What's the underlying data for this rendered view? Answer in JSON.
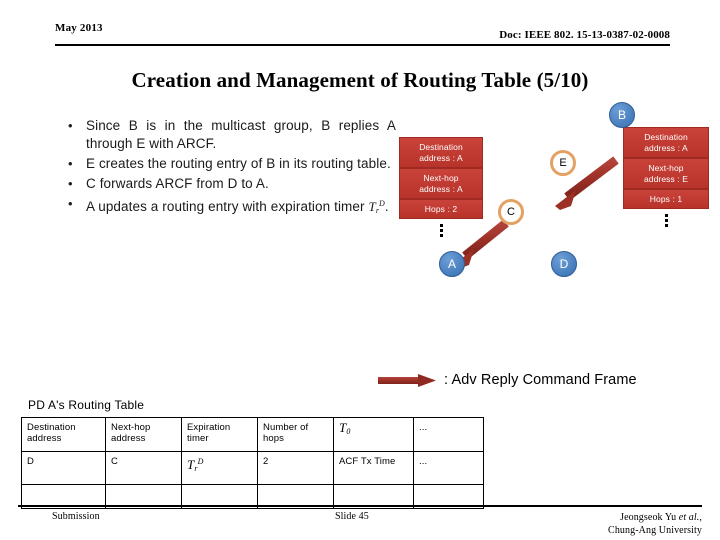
{
  "header": {
    "date": "May 2013",
    "doc": "Doc: IEEE 802. 15-13-0387-02-0008"
  },
  "title": "Creation and Management of Routing Table (5/10)",
  "bullets": [
    {
      "marker": "•",
      "text": "Since B is in the multicast group, B replies A through E with ARCF."
    },
    {
      "marker": "•",
      "text": "E creates the routing entry of B in its routing table."
    },
    {
      "marker": "•",
      "text": "C forwards ARCF from D to A."
    },
    {
      "marker": "•",
      "text": "A updates a routing entry with expiration timer"
    }
  ],
  "bullet_math": {
    "base": "T",
    "sub": "r",
    "sup": "D",
    "trail": "."
  },
  "diagram": {
    "nodes": [
      {
        "id": "node-b",
        "label": "B",
        "style": "filled"
      },
      {
        "id": "node-e",
        "label": "E",
        "style": "ring"
      },
      {
        "id": "node-c",
        "label": "C",
        "style": "ring"
      },
      {
        "id": "node-a",
        "label": "A",
        "style": "filled"
      },
      {
        "id": "node-d",
        "label": "D",
        "style": "filled"
      }
    ],
    "left_box": {
      "destination": "Destination\naddress : A",
      "destination_line1": "Destination",
      "destination_line2": "address : A",
      "nexthop_line1": "Next-hop",
      "nexthop_line2": "address : A",
      "hops": "Hops : 2"
    },
    "right_box": {
      "destination_line1": "Destination",
      "destination_line2": "address : A",
      "nexthop_line1": "Next-hop",
      "nexthop_line2": "address : E",
      "hops": "Hops : 1"
    },
    "colors": {
      "box_red": "#c0392b",
      "node_blue": "#4a80c0",
      "node_ring_orange": "#e3a264",
      "arrow_red": "#a83a30"
    }
  },
  "legend": {
    "label": ": Adv Reply Command Frame"
  },
  "routing_table": {
    "caption": "PD A's Routing Table",
    "columns": [
      "Destination\naddress",
      "Next-hop\naddress",
      "Expiration\ntimer",
      "Number of\nhops",
      "T0",
      "..."
    ],
    "columns_split": [
      {
        "l1": "Destination",
        "l2": "address"
      },
      {
        "l1": "Next-hop",
        "l2": "address"
      },
      {
        "l1": "Expiration",
        "l2": "timer"
      },
      {
        "l1": "Number of",
        "l2": "hops"
      },
      {
        "l1": "T",
        "sub": "0",
        "l2": ""
      },
      {
        "l1": "...",
        "l2": ""
      }
    ],
    "rows": [
      {
        "destination": "D",
        "nexthop": "C",
        "expiration_base": "T",
        "expiration_sub": "r",
        "expiration_sup": "D",
        "hops": "2",
        "t0": "ACF Tx Time",
        "more": "..."
      },
      {
        "destination": "",
        "nexthop": "",
        "expiration": "",
        "hops": "",
        "t0": "",
        "more": ""
      }
    ]
  },
  "footer": {
    "submission": "Submission",
    "slide": "Slide 45",
    "author_line1_a": "Jeongseok Yu ",
    "author_line1_b": "et al.",
    "author_line1_c": ",",
    "author_line2": "Chung-Ang University"
  }
}
